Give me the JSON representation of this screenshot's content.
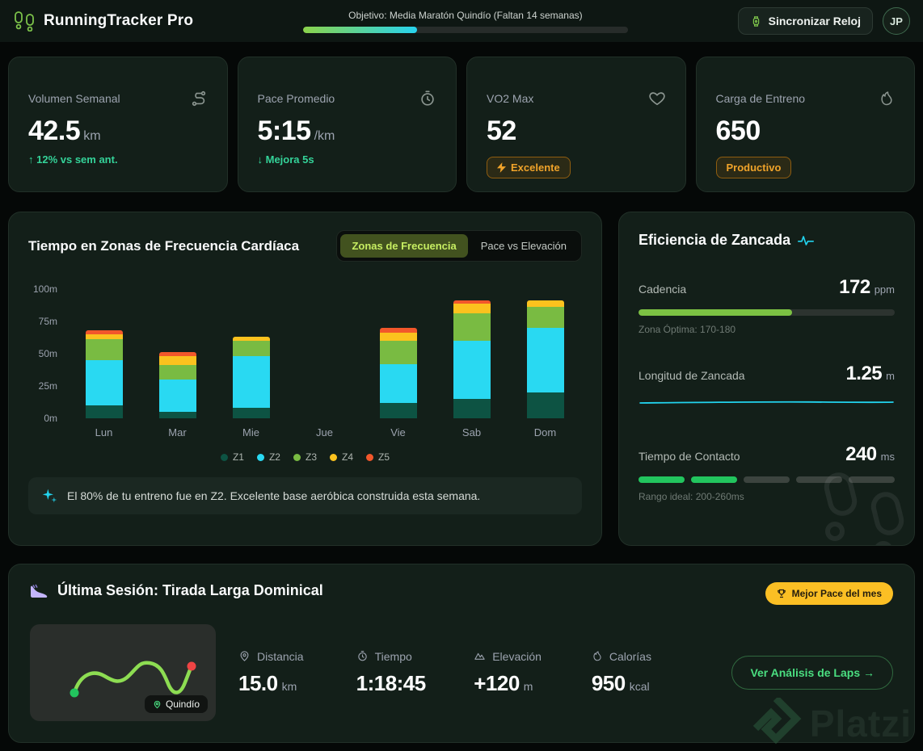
{
  "header": {
    "app_title": "RunningTracker Pro",
    "objective_label": "Objetivo: Media Maratón Quindío (Faltan 14 semanas)",
    "objective_progress_pct": 35,
    "sync_button_label": "Sincronizar Reloj",
    "avatar_initials": "JP"
  },
  "stat_cards": [
    {
      "label": "Volumen Semanal",
      "icon": "route-icon",
      "value": "42.5",
      "unit": "km",
      "trend": "↑ 12% vs sem ant."
    },
    {
      "label": "Pace Promedio",
      "icon": "stopwatch-icon",
      "value": "5:15",
      "unit": "/km",
      "trend": "↓ Mejora 5s"
    },
    {
      "label": "VO2 Max",
      "icon": "heart-icon",
      "value": "52",
      "badge": "Excelente"
    },
    {
      "label": "Carga de Entreno",
      "icon": "flame-icon",
      "value": "650",
      "badge": "Productivo"
    }
  ],
  "zones_panel": {
    "title": "Tiempo en Zonas de Frecuencia Cardíaca",
    "toggle": {
      "active": "Zonas de Frecuencia",
      "inactive": "Pace vs Elevación"
    },
    "insight": "El 80% de tu entreno fue en Z2. Excelente base aeróbica construida esta semana."
  },
  "chart_data": {
    "type": "bar",
    "stacked": true,
    "categories": [
      "Lun",
      "Mar",
      "Mie",
      "Jue",
      "Vie",
      "Sab",
      "Dom"
    ],
    "series": [
      {
        "name": "Z1",
        "color": "#0d5343",
        "values": [
          10,
          5,
          8,
          0,
          12,
          15,
          20
        ]
      },
      {
        "name": "Z2",
        "color": "#29d9f2",
        "values": [
          35,
          25,
          40,
          0,
          30,
          45,
          50
        ]
      },
      {
        "name": "Z3",
        "color": "#79bb42",
        "values": [
          16,
          11,
          12,
          0,
          18,
          21,
          16
        ]
      },
      {
        "name": "Z4",
        "color": "#fbc21e",
        "values": [
          4,
          7,
          3,
          0,
          6,
          8,
          5
        ]
      },
      {
        "name": "Z5",
        "color": "#f2572b",
        "values": [
          3,
          3,
          0,
          0,
          4,
          2,
          0
        ]
      }
    ],
    "yticks": [
      "0m",
      "25m",
      "50m",
      "75m",
      "100m"
    ],
    "ylim": [
      0,
      100
    ],
    "xlabel": "",
    "ylabel": "",
    "grid": false,
    "legend_position": "bottom"
  },
  "efficiency": {
    "title": "Eficiencia de Zancada",
    "metrics": [
      {
        "label": "Cadencia",
        "value": "172",
        "unit": "ppm",
        "note": "Zona Óptima: 170-180",
        "bar_pct": 60
      },
      {
        "label": "Longitud de Zancada",
        "value": "1.25",
        "unit": "m"
      },
      {
        "label": "Tiempo de Contacto",
        "value": "240",
        "unit": "ms",
        "note": "Rango ideal: 200-260ms",
        "segments_total": 5,
        "segments_filled": 2
      }
    ]
  },
  "session": {
    "title": "Última Sesión: Tirada Larga Dominical",
    "badge": "Mejor Pace del mes",
    "map_label": "Quindío",
    "stats": [
      {
        "icon": "pin-icon",
        "label": "Distancia",
        "value": "15.0",
        "unit": "km"
      },
      {
        "icon": "stopwatch-icon",
        "label": "Tiempo",
        "value": "1:18:45",
        "unit": ""
      },
      {
        "icon": "mountain-icon",
        "label": "Elevación",
        "value": "+120",
        "unit": "m"
      },
      {
        "icon": "flame-icon",
        "label": "Calorías",
        "value": "950",
        "unit": "kcal"
      }
    ],
    "cta_label": "Ver Análisis de Laps →"
  },
  "watermark": "Platzi",
  "colors": {
    "accent_green": "#7cc24a",
    "accent_cyan": "#22d3ee",
    "amber": "#f0a32a",
    "yellow_badge": "#fbbf24",
    "trend_green": "#34d399"
  }
}
